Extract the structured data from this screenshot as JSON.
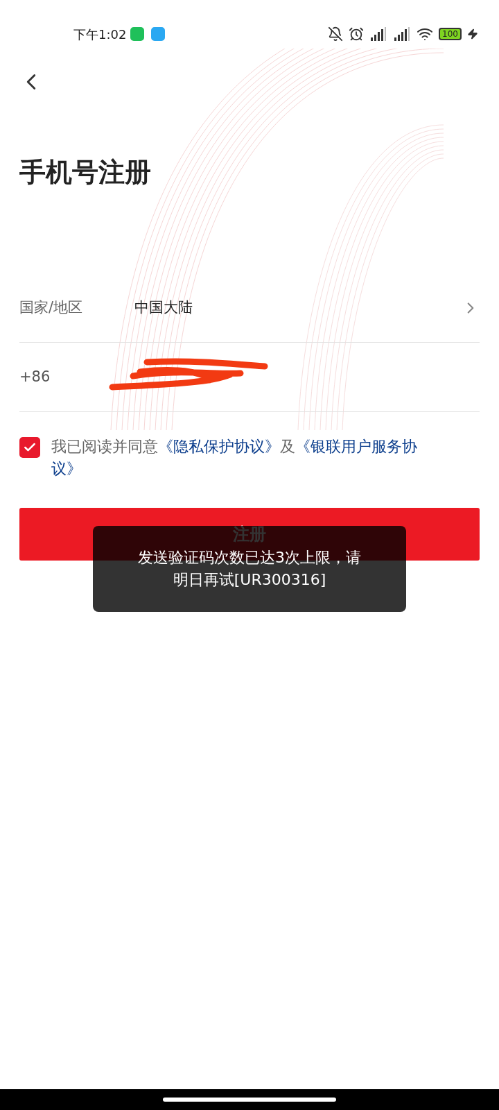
{
  "status_bar": {
    "time": "下午1:02",
    "battery": "100"
  },
  "title": "手机号注册",
  "region": {
    "label": "国家/地区",
    "value": "中国大陆"
  },
  "phone": {
    "prefix": "+86"
  },
  "agreement": {
    "checked": true,
    "text": "我已阅读并同意",
    "links": [
      "《隐私保护协议》",
      "《银联用户服务协议》"
    ],
    "joiner": "及"
  },
  "submit": {
    "label": "注册"
  },
  "toast": {
    "message": "发送验证码次数已达3次上限，请明日再试[UR300316]"
  }
}
